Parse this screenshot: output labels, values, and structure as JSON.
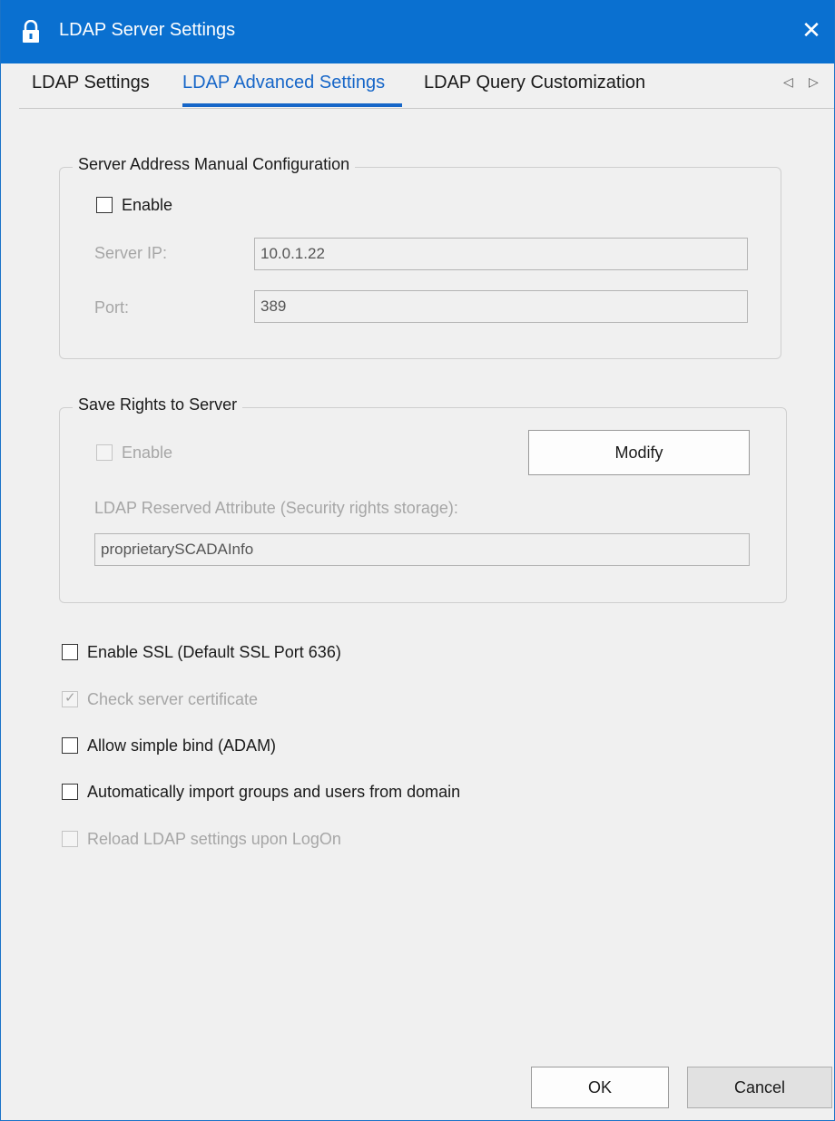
{
  "window": {
    "title": "LDAP Server Settings",
    "close_glyph": "✕",
    "title_icon": "lock-icon"
  },
  "tabs": [
    {
      "label": "LDAP Settings",
      "active": false
    },
    {
      "label": "LDAP Advanced Settings",
      "active": true
    },
    {
      "label": "LDAP Query Customization",
      "active": false
    }
  ],
  "tab_scroll": {
    "left": "◁",
    "right": "▷"
  },
  "server_address": {
    "legend": "Server Address Manual Configuration",
    "enable_label": "Enable",
    "enable_checked": false,
    "server_ip_label": "Server IP:",
    "server_ip_value": "10.0.1.22",
    "port_label": "Port:",
    "port_value": "389"
  },
  "save_rights": {
    "legend": "Save Rights to Server",
    "enable_label": "Enable",
    "enable_checked": false,
    "modify_label": "Modify",
    "attribute_label": "LDAP Reserved Attribute (Security rights storage):",
    "attribute_value": "proprietarySCADAInfo"
  },
  "options": {
    "enable_ssl": "Enable SSL (Default SSL Port 636)",
    "check_cert": "Check server certificate",
    "check_mark": "✓",
    "simple_bind": "Allow simple bind (ADAM)",
    "auto_import": "Automatically import groups and users from domain",
    "reload_settings": "Reload LDAP settings upon LogOn"
  },
  "footer": {
    "ok_label": "OK",
    "cancel_label": "Cancel"
  },
  "colors": {
    "title_bar": "#0a70d0",
    "accent": "#1666c8"
  }
}
